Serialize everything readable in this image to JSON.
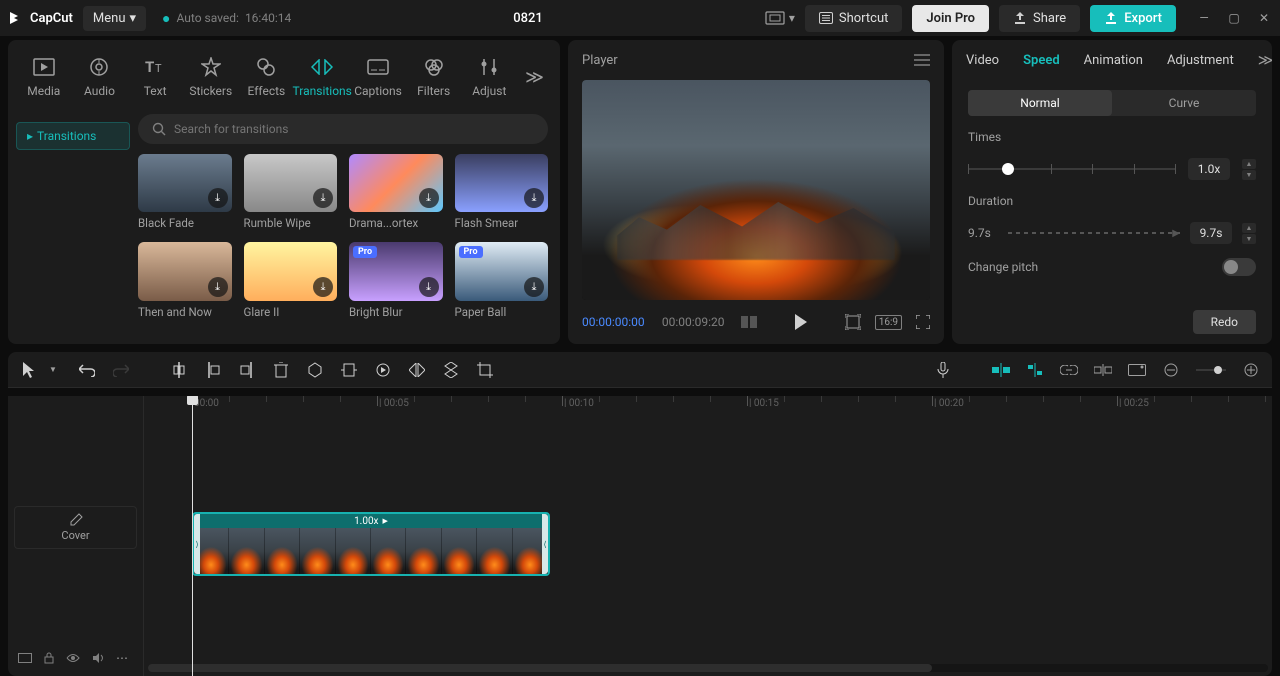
{
  "app": {
    "name": "CapCut",
    "menu": "Menu",
    "autosave_prefix": "Auto saved:",
    "autosave_time": "16:40:14",
    "project_title": "0821"
  },
  "titlebar": {
    "shortcut": "Shortcut",
    "join_pro": "Join Pro",
    "share": "Share",
    "export": "Export"
  },
  "library": {
    "tabs": [
      "Media",
      "Audio",
      "Text",
      "Stickers",
      "Effects",
      "Transitions",
      "Captions",
      "Filters",
      "Adjust"
    ],
    "active_tab": 5,
    "side_item": "Transitions",
    "search_placeholder": "Search for transitions",
    "items": [
      {
        "name": "Black Fade",
        "pro": false
      },
      {
        "name": "Rumble Wipe",
        "pro": false
      },
      {
        "name": "Drama...ortex",
        "pro": false
      },
      {
        "name": "Flash Smear",
        "pro": false
      },
      {
        "name": "Then and Now",
        "pro": false
      },
      {
        "name": "Glare II",
        "pro": false
      },
      {
        "name": "Bright Blur",
        "pro": true
      },
      {
        "name": "Paper Ball",
        "pro": true
      }
    ]
  },
  "player": {
    "title": "Player",
    "current_time": "00:00:00:00",
    "duration_time": "00:00:09:20",
    "aspect_badge": "16:9"
  },
  "inspector": {
    "tabs": [
      "Video",
      "Speed",
      "Animation",
      "Adjustment"
    ],
    "active_tab": 1,
    "mode_options": [
      "Normal",
      "Curve"
    ],
    "mode_active": 0,
    "times_label": "Times",
    "times_value": "1.0x",
    "times_slider_percent": 19,
    "duration_label": "Duration",
    "duration_left": "9.7s",
    "duration_value": "9.7s",
    "change_pitch_label": "Change pitch",
    "redo": "Redo"
  },
  "timeline": {
    "cover_btn": "Cover",
    "clip_speed": "1.00x",
    "ruler_labels": [
      "00:00",
      "00:05",
      "00:10",
      "00:15",
      "00:20",
      "00:25"
    ]
  },
  "thumb_colors": [
    "linear-gradient(#6b7c8e, #2e3a47)",
    "linear-gradient(#c8c8c8, #888)",
    "linear-gradient(135deg,#b08aff,#ff8a5c,#5cc8ff)",
    "linear-gradient(#3a3e60,#8aa0ff)",
    "linear-gradient(#d9b89a,#7a5c48)",
    "linear-gradient(#fff5a0,#ffae5c)",
    "linear-gradient(#4a3a6e,#c8a0ff)",
    "linear-gradient(#e0ecf5,#3a5a7a)"
  ]
}
